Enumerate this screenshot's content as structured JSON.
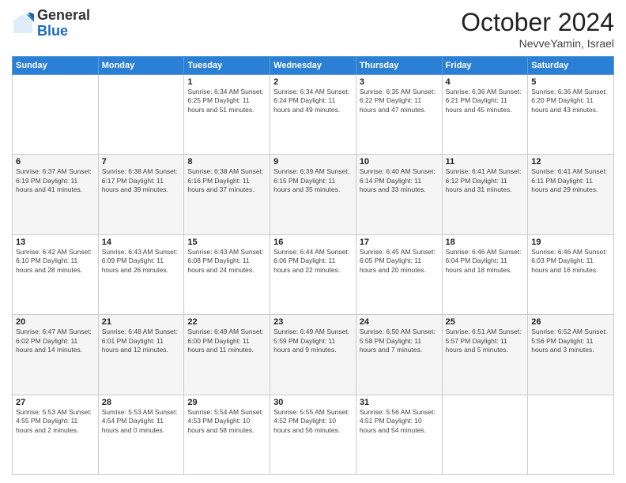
{
  "header": {
    "logo_line1": "General",
    "logo_line2": "Blue",
    "month_title": "October 2024",
    "subtitle": "NevveYamin, Israel"
  },
  "weekdays": [
    "Sunday",
    "Monday",
    "Tuesday",
    "Wednesday",
    "Thursday",
    "Friday",
    "Saturday"
  ],
  "weeks": [
    [
      {
        "day": "",
        "info": ""
      },
      {
        "day": "",
        "info": ""
      },
      {
        "day": "1",
        "info": "Sunrise: 6:34 AM\nSunset: 6:25 PM\nDaylight: 11 hours and 51 minutes."
      },
      {
        "day": "2",
        "info": "Sunrise: 6:34 AM\nSunset: 6:24 PM\nDaylight: 11 hours and 49 minutes."
      },
      {
        "day": "3",
        "info": "Sunrise: 6:35 AM\nSunset: 6:22 PM\nDaylight: 11 hours and 47 minutes."
      },
      {
        "day": "4",
        "info": "Sunrise: 6:36 AM\nSunset: 6:21 PM\nDaylight: 11 hours and 45 minutes."
      },
      {
        "day": "5",
        "info": "Sunrise: 6:36 AM\nSunset: 6:20 PM\nDaylight: 11 hours and 43 minutes."
      }
    ],
    [
      {
        "day": "6",
        "info": "Sunrise: 6:37 AM\nSunset: 6:19 PM\nDaylight: 11 hours and 41 minutes."
      },
      {
        "day": "7",
        "info": "Sunrise: 6:38 AM\nSunset: 6:17 PM\nDaylight: 11 hours and 39 minutes."
      },
      {
        "day": "8",
        "info": "Sunrise: 6:38 AM\nSunset: 6:16 PM\nDaylight: 11 hours and 37 minutes."
      },
      {
        "day": "9",
        "info": "Sunrise: 6:39 AM\nSunset: 6:15 PM\nDaylight: 11 hours and 35 minutes."
      },
      {
        "day": "10",
        "info": "Sunrise: 6:40 AM\nSunset: 6:14 PM\nDaylight: 11 hours and 33 minutes."
      },
      {
        "day": "11",
        "info": "Sunrise: 6:41 AM\nSunset: 6:12 PM\nDaylight: 11 hours and 31 minutes."
      },
      {
        "day": "12",
        "info": "Sunrise: 6:41 AM\nSunset: 6:11 PM\nDaylight: 11 hours and 29 minutes."
      }
    ],
    [
      {
        "day": "13",
        "info": "Sunrise: 6:42 AM\nSunset: 6:10 PM\nDaylight: 11 hours and 28 minutes."
      },
      {
        "day": "14",
        "info": "Sunrise: 6:43 AM\nSunset: 6:09 PM\nDaylight: 11 hours and 26 minutes."
      },
      {
        "day": "15",
        "info": "Sunrise: 6:43 AM\nSunset: 6:08 PM\nDaylight: 11 hours and 24 minutes."
      },
      {
        "day": "16",
        "info": "Sunrise: 6:44 AM\nSunset: 6:06 PM\nDaylight: 11 hours and 22 minutes."
      },
      {
        "day": "17",
        "info": "Sunrise: 6:45 AM\nSunset: 6:05 PM\nDaylight: 11 hours and 20 minutes."
      },
      {
        "day": "18",
        "info": "Sunrise: 6:46 AM\nSunset: 6:04 PM\nDaylight: 11 hours and 18 minutes."
      },
      {
        "day": "19",
        "info": "Sunrise: 6:46 AM\nSunset: 6:03 PM\nDaylight: 11 hours and 16 minutes."
      }
    ],
    [
      {
        "day": "20",
        "info": "Sunrise: 6:47 AM\nSunset: 6:02 PM\nDaylight: 11 hours and 14 minutes."
      },
      {
        "day": "21",
        "info": "Sunrise: 6:48 AM\nSunset: 6:01 PM\nDaylight: 11 hours and 12 minutes."
      },
      {
        "day": "22",
        "info": "Sunrise: 6:49 AM\nSunset: 6:00 PM\nDaylight: 11 hours and 11 minutes."
      },
      {
        "day": "23",
        "info": "Sunrise: 6:49 AM\nSunset: 5:59 PM\nDaylight: 11 hours and 9 minutes."
      },
      {
        "day": "24",
        "info": "Sunrise: 6:50 AM\nSunset: 5:58 PM\nDaylight: 11 hours and 7 minutes."
      },
      {
        "day": "25",
        "info": "Sunrise: 6:51 AM\nSunset: 5:57 PM\nDaylight: 11 hours and 5 minutes."
      },
      {
        "day": "26",
        "info": "Sunrise: 6:52 AM\nSunset: 5:56 PM\nDaylight: 11 hours and 3 minutes."
      }
    ],
    [
      {
        "day": "27",
        "info": "Sunrise: 5:53 AM\nSunset: 4:55 PM\nDaylight: 11 hours and 2 minutes."
      },
      {
        "day": "28",
        "info": "Sunrise: 5:53 AM\nSunset: 4:54 PM\nDaylight: 11 hours and 0 minutes."
      },
      {
        "day": "29",
        "info": "Sunrise: 5:54 AM\nSunset: 4:53 PM\nDaylight: 10 hours and 58 minutes."
      },
      {
        "day": "30",
        "info": "Sunrise: 5:55 AM\nSunset: 4:52 PM\nDaylight: 10 hours and 56 minutes."
      },
      {
        "day": "31",
        "info": "Sunrise: 5:56 AM\nSunset: 4:51 PM\nDaylight: 10 hours and 54 minutes."
      },
      {
        "day": "",
        "info": ""
      },
      {
        "day": "",
        "info": ""
      }
    ]
  ]
}
